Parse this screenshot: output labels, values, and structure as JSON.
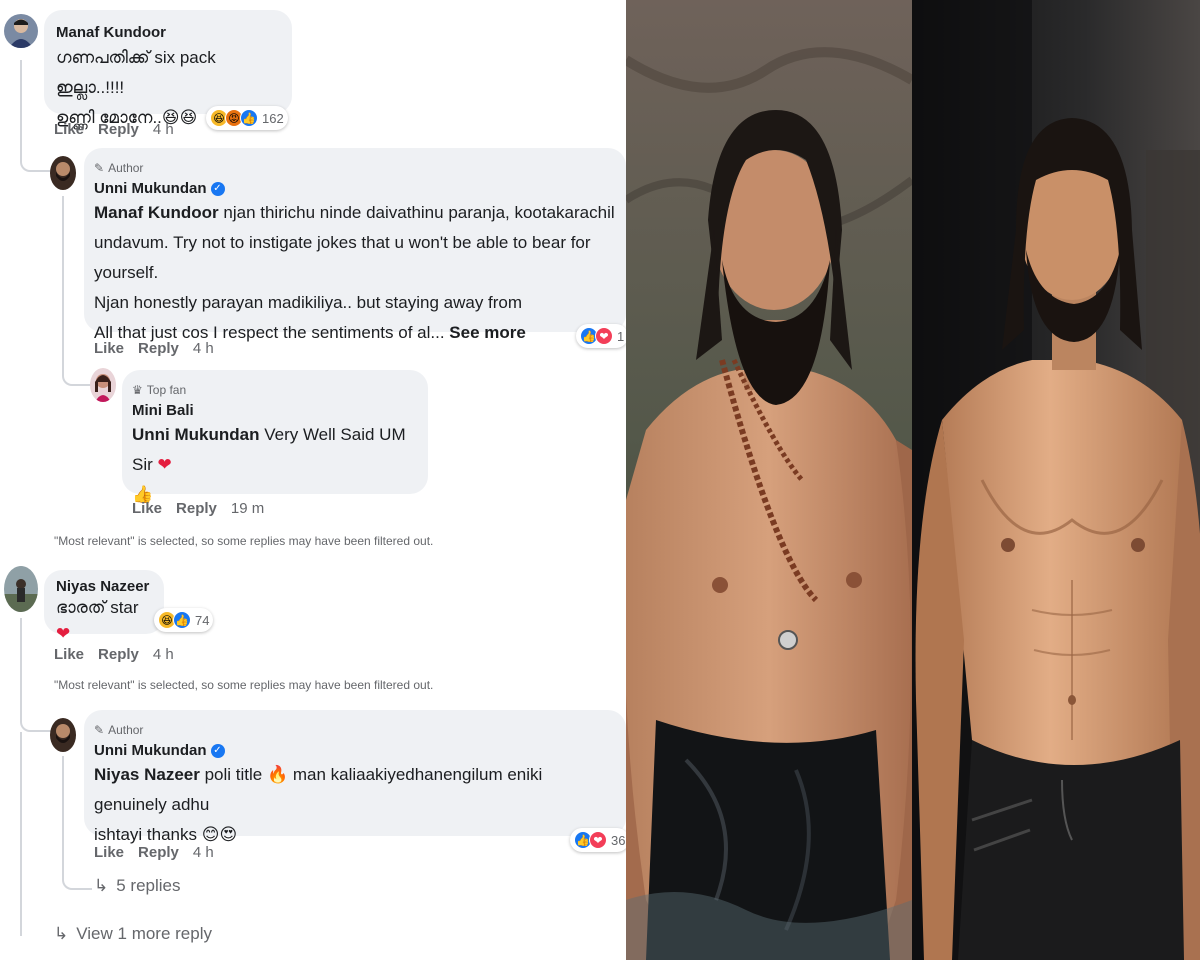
{
  "comments": [
    {
      "author": "Manaf Kundoor",
      "text_line1": "ഗണപതിക്ക് six pack ഇല്ലാ..!!!!",
      "text_line2": "ഉണ്ണി മോനേ..",
      "emoji": "😆😆",
      "actions": {
        "like": "Like",
        "reply": "Reply",
        "time": "4 h"
      },
      "reactions": {
        "icons": [
          "haha",
          "angry",
          "like"
        ],
        "count": "162"
      }
    },
    {
      "badge": "Author",
      "author": "Unni Mukundan",
      "mention": "Manaf Kundoor",
      "lines": [
        " njan thirichu ninde daivathinu paranja, kootakarachil",
        "undavum.  Try not to instigate jokes that u won't be able to bear for yourself.",
        "Njan honestly parayan madikiliya.. but staying away from",
        "All that just cos I respect the sentiments of al... "
      ],
      "see_more": "See more",
      "actions": {
        "like": "Like",
        "reply": "Reply",
        "time": "4 h"
      },
      "reactions": {
        "icons": [
          "like",
          "love"
        ],
        "count": "1"
      }
    },
    {
      "badge": "Top fan",
      "author": "Mini Bali",
      "mention": "Unni Mukundan",
      "text": " Very Well Said UM Sir ",
      "emoji_heart": "❤",
      "emoji_thumb": "👍",
      "actions": {
        "like": "Like",
        "reply": "Reply",
        "time": "19 m"
      }
    },
    {
      "filtered_notice": "\"Most relevant\" is selected, so some replies may have been filtered out."
    },
    {
      "author": "Niyas Nazeer",
      "text": "ഭാരത് star",
      "emoji_heart": "❤",
      "actions": {
        "like": "Like",
        "reply": "Reply",
        "time": "4 h"
      },
      "reactions": {
        "icons": [
          "haha",
          "like"
        ],
        "count": "74"
      }
    },
    {
      "filtered_notice": "\"Most relevant\" is selected, so some replies may have been filtered out."
    },
    {
      "badge": "Author",
      "author": "Unni Mukundan",
      "mention": "Niyas Nazeer",
      "line1": " poli title ",
      "line1_rest": " man kaliaakiyedhanengilum eniki genuinely adhu",
      "line2": "ishtayi thanks ",
      "emoji_fire": "🔥",
      "emoji_end": "😊😍",
      "actions": {
        "like": "Like",
        "reply": "Reply",
        "time": "4 h"
      },
      "reactions": {
        "icons": [
          "like",
          "love"
        ],
        "count": "36"
      },
      "replies_link": "5 replies"
    }
  ],
  "view_more": "View 1 more reply",
  "icons": {
    "reply_arrow": "reply-arrow-icon",
    "pencil": "pencil-icon",
    "top_fan": "top-fan-icon",
    "verified": "verified-icon"
  },
  "colors": {
    "bubble": "#eff1f4",
    "meta_text": "#65676b",
    "like_blue": "#1877f2",
    "love_red": "#f33e58",
    "haha_yellow": "#f7b928"
  }
}
